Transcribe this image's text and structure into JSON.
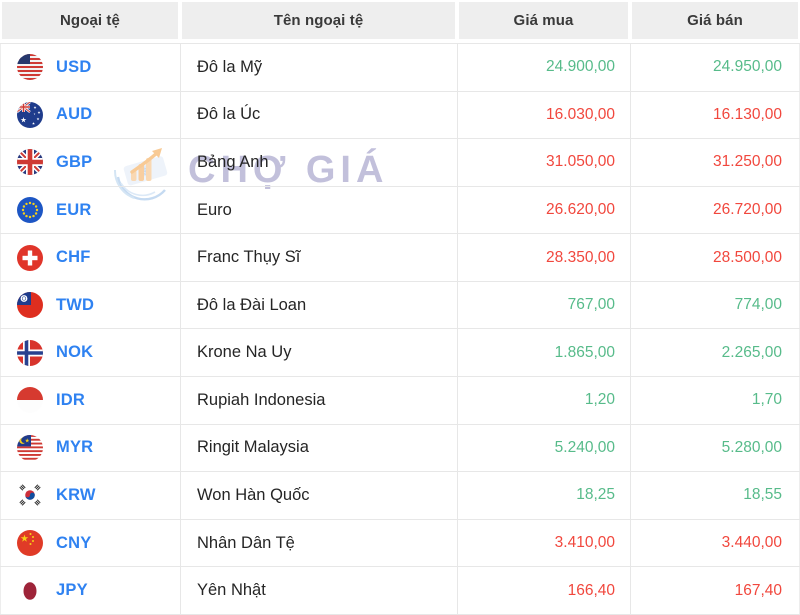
{
  "watermark": {
    "text": "CHỢ GIÁ",
    "logo": "cho-gia-logo-icon"
  },
  "colors": {
    "link_blue": "#2f82f1",
    "price_up_green": "#57bb8a",
    "price_down_red": "#f1473d",
    "header_bg": "#eeeeee",
    "watermark_lavender": "#c8c5e0"
  },
  "table": {
    "columns": [
      {
        "label": "Ngoại tệ"
      },
      {
        "label": "Tên ngoại tệ"
      },
      {
        "label": "Giá mua"
      },
      {
        "label": "Giá bán"
      }
    ],
    "rows": [
      {
        "code": "USD",
        "flag": "usd-flag-icon",
        "name": "Đô la Mỹ",
        "buy": "24.900,00",
        "sell": "24.950,00",
        "trend": "up"
      },
      {
        "code": "AUD",
        "flag": "aud-flag-icon",
        "name": "Đô la Úc",
        "buy": "16.030,00",
        "sell": "16.130,00",
        "trend": "down"
      },
      {
        "code": "GBP",
        "flag": "gbp-flag-icon",
        "name": "Bảng Anh",
        "buy": "31.050,00",
        "sell": "31.250,00",
        "trend": "down"
      },
      {
        "code": "EUR",
        "flag": "eur-flag-icon",
        "name": "Euro",
        "buy": "26.620,00",
        "sell": "26.720,00",
        "trend": "down"
      },
      {
        "code": "CHF",
        "flag": "chf-flag-icon",
        "name": "Franc Thụy Sĩ",
        "buy": "28.350,00",
        "sell": "28.500,00",
        "trend": "down"
      },
      {
        "code": "TWD",
        "flag": "twd-flag-icon",
        "name": "Đô la Đài Loan",
        "buy": "767,00",
        "sell": "774,00",
        "trend": "up"
      },
      {
        "code": "NOK",
        "flag": "nok-flag-icon",
        "name": "Krone Na Uy",
        "buy": "1.865,00",
        "sell": "2.265,00",
        "trend": "up"
      },
      {
        "code": "IDR",
        "flag": "idr-flag-icon",
        "name": "Rupiah Indonesia",
        "buy": "1,20",
        "sell": "1,70",
        "trend": "up"
      },
      {
        "code": "MYR",
        "flag": "myr-flag-icon",
        "name": "Ringit Malaysia",
        "buy": "5.240,00",
        "sell": "5.280,00",
        "trend": "up"
      },
      {
        "code": "KRW",
        "flag": "krw-flag-icon",
        "name": "Won Hàn Quốc",
        "buy": "18,25",
        "sell": "18,55",
        "trend": "up"
      },
      {
        "code": "CNY",
        "flag": "cny-flag-icon",
        "name": "Nhân Dân Tệ",
        "buy": "3.410,00",
        "sell": "3.440,00",
        "trend": "down"
      },
      {
        "code": "JPY",
        "flag": "jpy-flag-icon",
        "name": "Yên Nhật",
        "buy": "166,40",
        "sell": "167,40",
        "trend": "down"
      }
    ]
  }
}
